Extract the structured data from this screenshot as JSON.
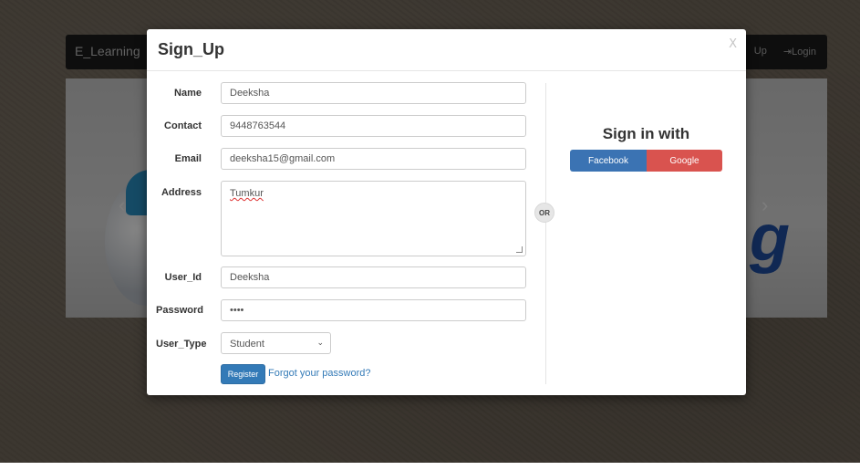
{
  "navbar": {
    "brand": "E_Learning",
    "signup_fragment": "Up",
    "login_label": "Login"
  },
  "modal": {
    "title": "Sign_Up",
    "close_label": "X",
    "fields": {
      "name": {
        "label": "Name",
        "value": "Deeksha"
      },
      "contact": {
        "label": "Contact",
        "value": "9448763544"
      },
      "email": {
        "label": "Email",
        "value": "deeksha15@gmail.com"
      },
      "address": {
        "label": "Address",
        "value": "Tumkur"
      },
      "user_id": {
        "label": "User_Id",
        "value": "Deeksha"
      },
      "password": {
        "label": "Password",
        "value": "••••"
      },
      "user_type": {
        "label": "User_Type",
        "selected": "Student"
      }
    },
    "register_label": "Register",
    "forgot_label": "Forgot your password?",
    "or_label": "OR",
    "signin_title": "Sign in with",
    "facebook_label": "Facebook",
    "google_label": "Google"
  },
  "colors": {
    "primary": "#337ab7",
    "facebook": "#3b73b3",
    "google": "#d9534f"
  }
}
